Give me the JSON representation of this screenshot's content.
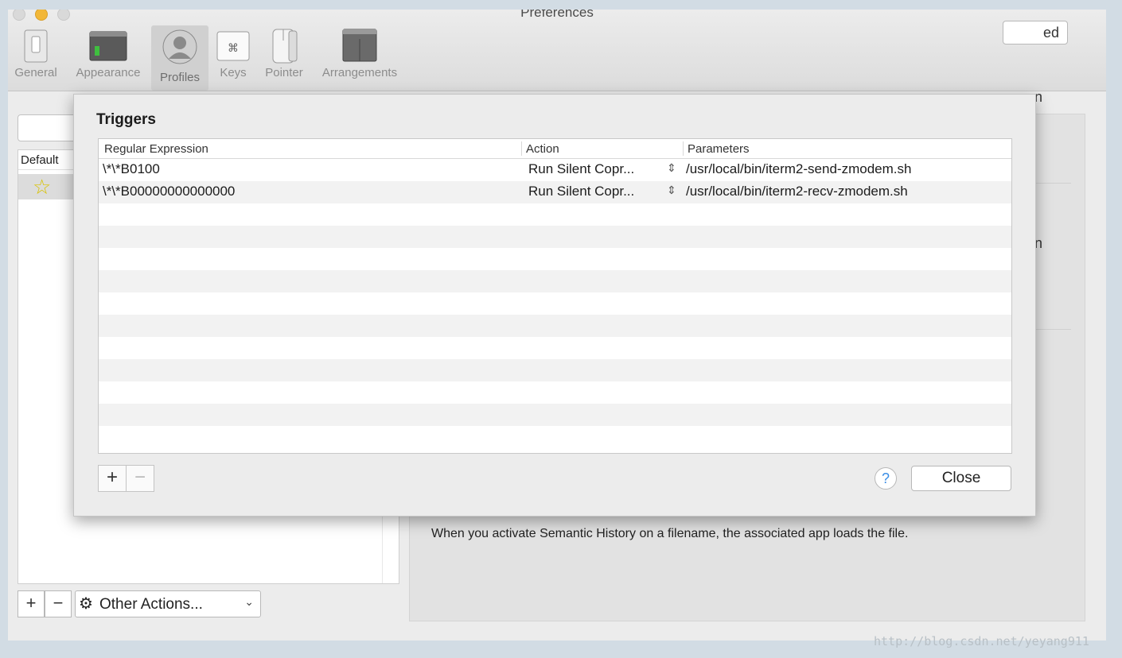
{
  "window": {
    "title": "Preferences"
  },
  "toolbar": {
    "items": [
      {
        "label": "General",
        "icon": "switch-icon"
      },
      {
        "label": "Appearance",
        "icon": "window-icon"
      },
      {
        "label": "Profiles",
        "icon": "person-icon",
        "selected": true
      },
      {
        "label": "Keys",
        "icon": "command-key-icon"
      },
      {
        "label": "Pointer",
        "icon": "mouse-icon"
      },
      {
        "label": "Arrangements",
        "icon": "arrangement-windows-icon"
      }
    ]
  },
  "profiles": {
    "header_label": "Default",
    "default_icon": "star-icon",
    "default_icon_glyph": "☆"
  },
  "list_actions": {
    "add_glyph": "+",
    "remove_glyph": "−",
    "gear_glyph": "⚙",
    "other_actions_label": "Other Actions...",
    "chevron_glyph": "⌄"
  },
  "right_panel": {
    "advanced_button_partial": "ed",
    "row1_partial": "n",
    "row2_partial": "n",
    "semantic_history_note": "When you activate Semantic History on a filename, the associated app loads the file."
  },
  "triggers_sheet": {
    "title": "Triggers",
    "columns": [
      "Regular Expression",
      "Action",
      "Parameters"
    ],
    "rows": [
      {
        "regex": "\\*\\*B0100",
        "action": "Run Silent Copr...",
        "parameters": "/usr/local/bin/iterm2-send-zmodem.sh"
      },
      {
        "regex": "\\*\\*B00000000000000",
        "action": "Run Silent Copr...",
        "parameters": "/usr/local/bin/iterm2-recv-zmodem.sh"
      }
    ],
    "updown_glyph": "⇕",
    "add_glyph": "+",
    "remove_glyph": "−",
    "help_glyph": "?",
    "close_label": "Close"
  },
  "watermark": "http://blog.csdn.net/yeyang911",
  "colors": {
    "minimize_traffic_light": "#f2b738",
    "help_accent": "#3a8ee6"
  }
}
